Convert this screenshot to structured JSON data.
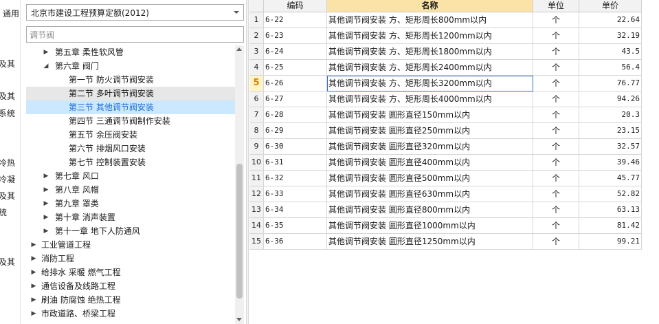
{
  "left_cutoff_texts": [
    "通用",
    "及其",
    "及其",
    "系统",
    "冷热",
    "冷凝",
    "及其",
    "统",
    "及其"
  ],
  "quota_select": {
    "value": "北京市建设工程预算定额(2012)"
  },
  "search": {
    "value": "调节阀"
  },
  "tree": {
    "items": [
      {
        "label": "第五章 柔性软风管",
        "level": 1,
        "toggle": "▶",
        "state": ""
      },
      {
        "label": "第六章 阀门",
        "level": 1,
        "toggle": "◢",
        "state": ""
      },
      {
        "label": "第一节 防火调节阀安装",
        "level": 2,
        "toggle": "",
        "state": ""
      },
      {
        "label": "第二节 多叶调节阀安装",
        "level": 2,
        "toggle": "",
        "state": "hover"
      },
      {
        "label": "第三节 其他调节阀安装",
        "level": 2,
        "toggle": "",
        "state": "selected"
      },
      {
        "label": "第四节 三通调节阀制作安装",
        "level": 2,
        "toggle": "",
        "state": ""
      },
      {
        "label": "第五节 余压阀安装",
        "level": 2,
        "toggle": "",
        "state": ""
      },
      {
        "label": "第六节 排烟风口安装",
        "level": 2,
        "toggle": "",
        "state": ""
      },
      {
        "label": "第七节 控制装置安装",
        "level": 2,
        "toggle": "",
        "state": ""
      },
      {
        "label": "第七章 风口",
        "level": 1,
        "toggle": "▶",
        "state": ""
      },
      {
        "label": "第八章 风帽",
        "level": 1,
        "toggle": "▶",
        "state": ""
      },
      {
        "label": "第九章 罩类",
        "level": 1,
        "toggle": "▶",
        "state": ""
      },
      {
        "label": "第十章 消声装置",
        "level": 1,
        "toggle": "▶",
        "state": ""
      },
      {
        "label": "第十一章 地下人防通风",
        "level": 1,
        "toggle": "▶",
        "state": ""
      },
      {
        "label": "工业管道工程",
        "level": 0,
        "toggle": "▶",
        "state": ""
      },
      {
        "label": "消防工程",
        "level": 0,
        "toggle": "▶",
        "state": ""
      },
      {
        "label": "给排水 采暖 燃气工程",
        "level": 0,
        "toggle": "▶",
        "state": ""
      },
      {
        "label": "通信设备及线路工程",
        "level": 0,
        "toggle": "▶",
        "state": ""
      },
      {
        "label": "刷油 防腐蚀 绝热工程",
        "level": 0,
        "toggle": "▶",
        "state": ""
      },
      {
        "label": "市政道路、桥梁工程",
        "level": 0,
        "toggle": "▶",
        "state": ""
      }
    ]
  },
  "grid": {
    "columns": {
      "code": "编码",
      "name": "名称",
      "unit": "单位",
      "price": "单价"
    },
    "active_row": 5,
    "rows": [
      {
        "num": "1",
        "code": "6-22",
        "name": "其他调节阀安装 方、矩形周长800mm以内",
        "unit": "个",
        "price": "22.64"
      },
      {
        "num": "2",
        "code": "6-23",
        "name": "其他调节阀安装 方、矩形周长1200mm以内",
        "unit": "个",
        "price": "32.19"
      },
      {
        "num": "3",
        "code": "6-24",
        "name": "其他调节阀安装 方、矩形周长1800mm以内",
        "unit": "个",
        "price": "43.5"
      },
      {
        "num": "4",
        "code": "6-25",
        "name": "其他调节阀安装 方、矩形周长2400mm以内",
        "unit": "个",
        "price": "56.4"
      },
      {
        "num": "5",
        "code": "6-26",
        "name": "其他调节阀安装 方、矩形周长3200mm以内",
        "unit": "个",
        "price": "76.77"
      },
      {
        "num": "6",
        "code": "6-27",
        "name": "其他调节阀安装 方、矩形周长4000mm以内",
        "unit": "个",
        "price": "94.26"
      },
      {
        "num": "7",
        "code": "6-28",
        "name": "其他调节阀安装 圆形直径150mm以内",
        "unit": "个",
        "price": "20.3"
      },
      {
        "num": "8",
        "code": "6-29",
        "name": "其他调节阀安装 圆形直径250mm以内",
        "unit": "个",
        "price": "23.15"
      },
      {
        "num": "9",
        "code": "6-30",
        "name": "其他调节阀安装 圆形直径320mm以内",
        "unit": "个",
        "price": "32.57"
      },
      {
        "num": "10",
        "code": "6-31",
        "name": "其他调节阀安装 圆形直径400mm以内",
        "unit": "个",
        "price": "39.46"
      },
      {
        "num": "11",
        "code": "6-32",
        "name": "其他调节阀安装 圆形直径500mm以内",
        "unit": "个",
        "price": "45.77"
      },
      {
        "num": "12",
        "code": "6-33",
        "name": "其他调节阀安装 圆形直径630mm以内",
        "unit": "个",
        "price": "52.82"
      },
      {
        "num": "13",
        "code": "6-34",
        "name": "其他调节阀安装 圆形直径800mm以内",
        "unit": "个",
        "price": "63.13"
      },
      {
        "num": "14",
        "code": "6-35",
        "name": "其他调节阀安装 圆形直径1000mm以内",
        "unit": "个",
        "price": "81.42"
      },
      {
        "num": "15",
        "code": "6-36",
        "name": "其他调节阀安装 圆形直径1250mm以内",
        "unit": "个",
        "price": "99.21"
      }
    ]
  }
}
